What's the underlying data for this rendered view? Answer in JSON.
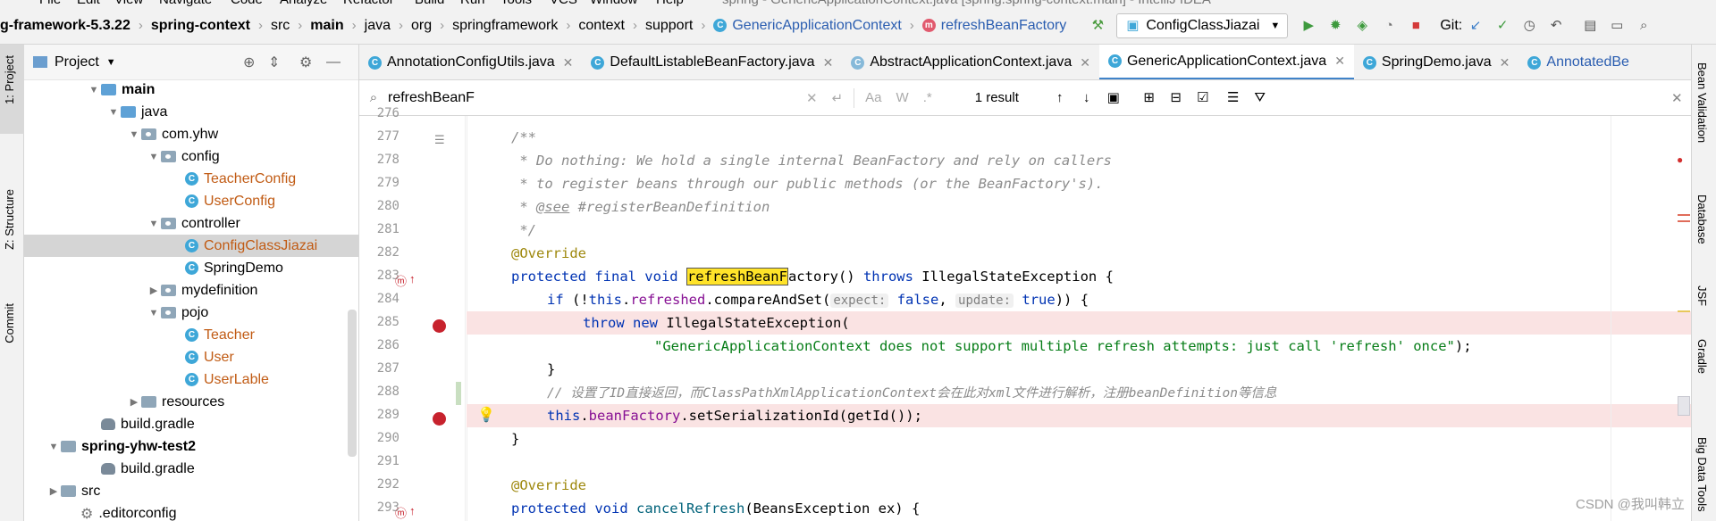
{
  "menu": [
    "File",
    "Edit",
    "View",
    "Navigate",
    "Code",
    "Analyze",
    "Refactor",
    "Build",
    "Run",
    "Tools",
    "VCS",
    "Window",
    "Help"
  ],
  "window_title": "spring - GenericApplicationContext.java [spring.spring-context.main] - IntelliJ IDEA",
  "breadcrumbs": [
    "g-framework-5.3.22",
    "spring-context",
    "src",
    "main",
    "java",
    "org",
    "springframework",
    "context",
    "support",
    "GenericApplicationContext",
    "refreshBeanFactory"
  ],
  "run_config": "ConfigClassJiazai",
  "git_label": "Git:",
  "left_tool_windows": [
    "1: Project",
    "Z: Structure",
    "Commit"
  ],
  "project_panel": {
    "title": "Project",
    "tree": [
      {
        "label": "main",
        "bold": true,
        "kind": "folder-blue"
      },
      {
        "label": "java",
        "kind": "folder-blue"
      },
      {
        "label": "com.yhw",
        "kind": "pkg"
      },
      {
        "label": "config",
        "kind": "pkg"
      },
      {
        "label": "TeacherConfig",
        "kind": "class"
      },
      {
        "label": "UserConfig",
        "kind": "class"
      },
      {
        "label": "controller",
        "kind": "pkg"
      },
      {
        "label": "ConfigClassJiazai",
        "kind": "class",
        "selected": true
      },
      {
        "label": "SpringDemo",
        "kind": "class"
      },
      {
        "label": "mydefinition",
        "kind": "pkg"
      },
      {
        "label": "pojo",
        "kind": "pkg"
      },
      {
        "label": "Teacher",
        "kind": "class"
      },
      {
        "label": "User",
        "kind": "class"
      },
      {
        "label": "UserLable",
        "kind": "class"
      },
      {
        "label": "resources",
        "kind": "folder"
      },
      {
        "label": "build.gradle",
        "kind": "gradle"
      },
      {
        "label": "spring-yhw-test2",
        "bold": true,
        "kind": "folder"
      },
      {
        "label": "build.gradle",
        "kind": "gradle"
      },
      {
        "label": "src",
        "kind": "folder"
      },
      {
        "label": ".editorconfig",
        "kind": "config"
      }
    ]
  },
  "tabs": [
    {
      "label": "AnnotationConfigUtils.java"
    },
    {
      "label": "DefaultListableBeanFactory.java"
    },
    {
      "label": "AbstractApplicationContext.java"
    },
    {
      "label": "GenericApplicationContext.java",
      "active": true
    },
    {
      "label": "SpringDemo.java"
    },
    {
      "label": "AnnotatedBe"
    }
  ],
  "find": {
    "query": "refreshBeanF",
    "result_count": "1 result",
    "options": [
      "Aa",
      "W",
      ".*"
    ]
  },
  "line_numbers": [
    "276",
    "277",
    "278",
    "279",
    "280",
    "281",
    "282",
    "283",
    "284",
    "285",
    "286",
    "287",
    "288",
    "289",
    "290",
    "291",
    "292",
    "293"
  ],
  "code": {
    "l277": "/**",
    "l278": " * Do nothing: We hold a single internal BeanFactory and rely on callers",
    "l279": " * to register beans through our public methods (or the BeanFactory's).",
    "l280_see": "@see",
    "l280_rest": " #registerBeanDefinition",
    "l281": " */",
    "l282": "@Override",
    "l283_mods": "protected final void ",
    "l283_match": "refreshBeanF",
    "l283_rest": "actory",
    "l283_tail": "() ",
    "l283_throws": "throws",
    "l283_exc": " IllegalStateException {",
    "l284_if": "if",
    "l284_a": " (!",
    "l284_this": "this",
    "l284_dot": ".",
    "l284_field": "refreshed",
    "l284_call": ".compareAndSet(",
    "l284_hint1": "expect:",
    "l284_false": "false",
    "l284_comma": ", ",
    "l284_hint2": "update:",
    "l284_true": "true",
    "l284_end": ")) {",
    "l285_throw": "throw new",
    "l285_rest": " IllegalStateException(",
    "l286": "\"GenericApplicationContext does not support multiple refresh attempts: just call 'refresh' once\"",
    "l286_end": ");",
    "l287": "}",
    "l288": "// 设置了ID直接返回，而ClassPathXmlApplicationContext会在此对xml文件进行解析，注册beanDefinition等信息",
    "l289_this": "this",
    "l289_dot": ".",
    "l289_field": "beanFactory",
    "l289_rest": ".setSerializationId(getId());",
    "l290": "}",
    "l292": "@Override",
    "l293_mods": "protected void ",
    "l293_name": "cancelRefresh",
    "l293_rest": "(BeansException ex) {"
  },
  "right_tool_windows": [
    "Bean Validation",
    "Database",
    "JSF",
    "Gradle",
    "Big Data Tools"
  ],
  "watermark": "CSDN @我叫韩立",
  "colors": {
    "keyword": "#0033b3",
    "comment": "#8c8c8c",
    "annotation": "#9e880d",
    "string": "#067d17",
    "field": "#871094",
    "breakpoint": "#c7222d",
    "match": "#ffe329"
  }
}
